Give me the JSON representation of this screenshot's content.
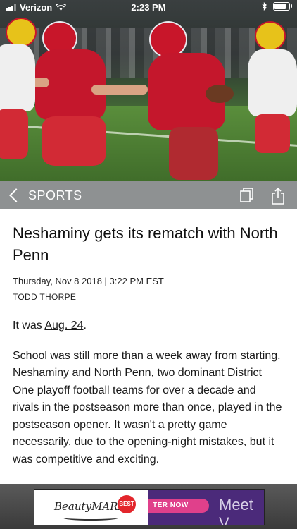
{
  "status_bar": {
    "carrier": "Verizon",
    "time": "2:23 PM"
  },
  "navbar": {
    "section": "SPORTS",
    "icons": [
      "back-chevron-icon",
      "copy-icon",
      "share-icon"
    ]
  },
  "article": {
    "headline": "Neshaminy gets its rematch with North Penn",
    "dateline": "Thursday, Nov 8 2018 | 3:22 PM EST",
    "byline": "TODD THORPE",
    "p1_prefix": "It was ",
    "p1_link": "Aug. 24",
    "p1_suffix": ".",
    "p2": "School was still more than a week away from starting. Neshaminy and North Penn, two dominant District One playoff football teams for over a decade and rivals in the postseason more than once, played in the postseason opener. It wasn't a pretty game necessarily, due to the opening-night mistakes, but it was competitive and exciting."
  },
  "ad": {
    "brand": "BeautyMARX",
    "badge": "BEST",
    "cta": "TER NOW",
    "tagline": "Meet V"
  },
  "colors": {
    "navbar": "#8e9192",
    "ad_purple": "#4b2a7a",
    "ad_pink": "#e0408b"
  }
}
